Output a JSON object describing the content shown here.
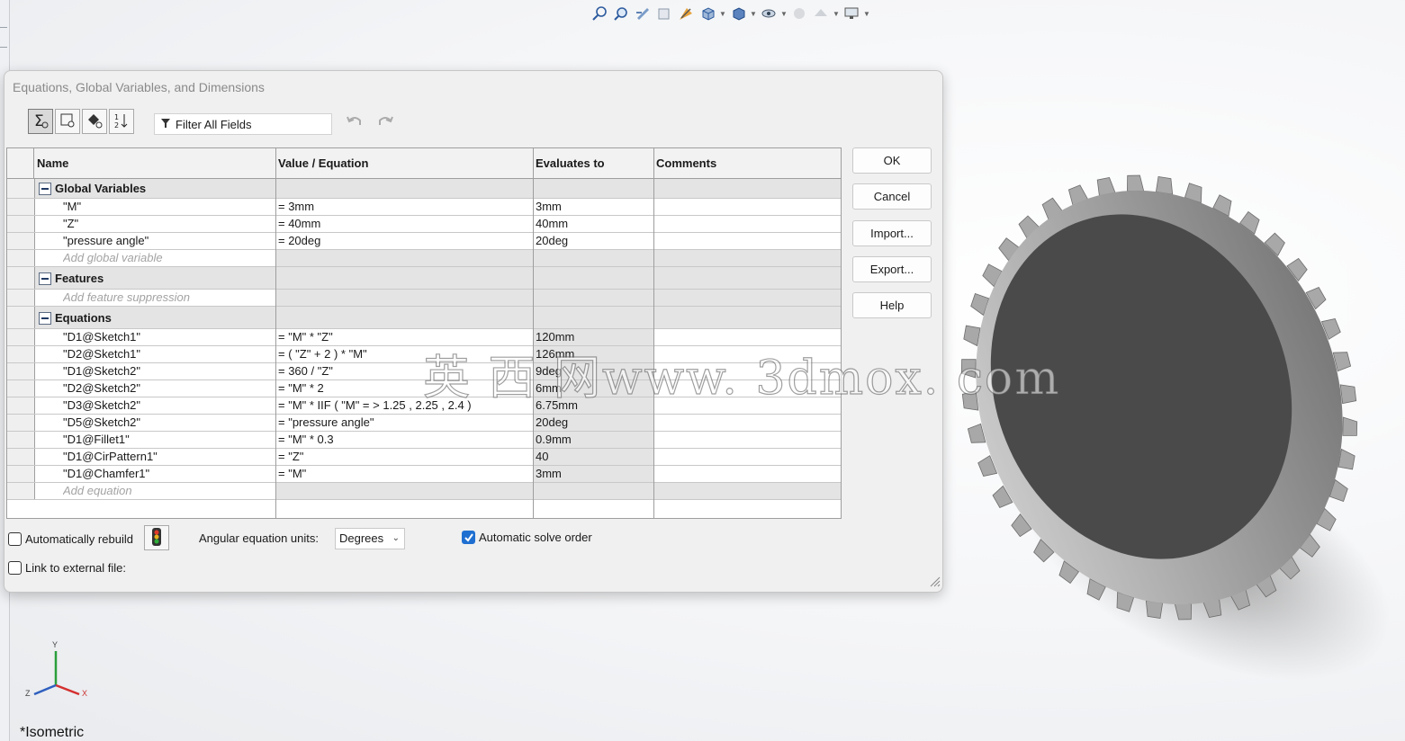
{
  "dialog": {
    "title": "Equations, Global Variables, and Dimensions",
    "filter_placeholder": "Filter All Fields"
  },
  "toolbar_icons": [
    "equation-view-icon",
    "sketch-equation-view-icon",
    "dimension-view-icon",
    "ordered-view-icon"
  ],
  "table": {
    "columns": [
      "Name",
      "Value / Equation",
      "Evaluates to",
      "Comments"
    ],
    "groups": {
      "global": "Global Variables",
      "features": "Features",
      "equations": "Equations"
    },
    "global_rows": [
      {
        "name": "\"M\"",
        "value": "= 3mm",
        "eval": "3mm"
      },
      {
        "name": "\"Z\"",
        "value": "= 40mm",
        "eval": "40mm"
      },
      {
        "name": "\"pressure angle\"",
        "value": "= 20deg",
        "eval": "20deg"
      }
    ],
    "add_global": "Add global variable",
    "add_feature": "Add feature suppression",
    "equation_rows": [
      {
        "name": "\"D1@Sketch1\"",
        "value": "= \"M\" * \"Z\"",
        "eval": "120mm"
      },
      {
        "name": "\"D2@Sketch1\"",
        "value": "= ( \"Z\" + 2 ) * \"M\"",
        "eval": "126mm"
      },
      {
        "name": "\"D1@Sketch2\"",
        "value": "= 360 / \"Z\"",
        "eval": "9deg"
      },
      {
        "name": "\"D2@Sketch2\"",
        "value": "= \"M\" * 2",
        "eval": "6mm"
      },
      {
        "name": "\"D3@Sketch2\"",
        "value": "= \"M\" * IIF ( \"M\" = > 1.25 , 2.25 , 2.4 )",
        "eval": "6.75mm"
      },
      {
        "name": "\"D5@Sketch2\"",
        "value": "= \"pressure angle\"",
        "eval": "20deg"
      },
      {
        "name": "\"D1@Fillet1\"",
        "value": "= \"M\" * 0.3",
        "eval": "0.9mm"
      },
      {
        "name": "\"D1@CirPattern1\"",
        "value": "= \"Z\"",
        "eval": "40"
      },
      {
        "name": "\"D1@Chamfer1\"",
        "value": "= \"M\"",
        "eval": "3mm"
      }
    ],
    "add_equation": "Add equation"
  },
  "buttons": {
    "ok": "OK",
    "cancel": "Cancel",
    "import": "Import...",
    "export": "Export...",
    "help": "Help"
  },
  "options": {
    "auto_rebuild": "Automatically rebuild",
    "auto_rebuild_checked": false,
    "angular_units_label": "Angular equation units:",
    "angular_units_value": "Degrees",
    "auto_solve": "Automatic solve order",
    "auto_solve_checked": true,
    "link_external": "Link to external file:",
    "link_external_checked": false
  },
  "viewport": {
    "view_name": "*Isometric",
    "axis_x": "X",
    "axis_y": "Y",
    "axis_z": "Z",
    "watermark": "英 西 网www. 3dmox. com"
  },
  "colors": {
    "gear_face": "#4a4a4a",
    "gear_teeth": "#a8a8a8",
    "checkbox_on": "#1f6fd1"
  }
}
